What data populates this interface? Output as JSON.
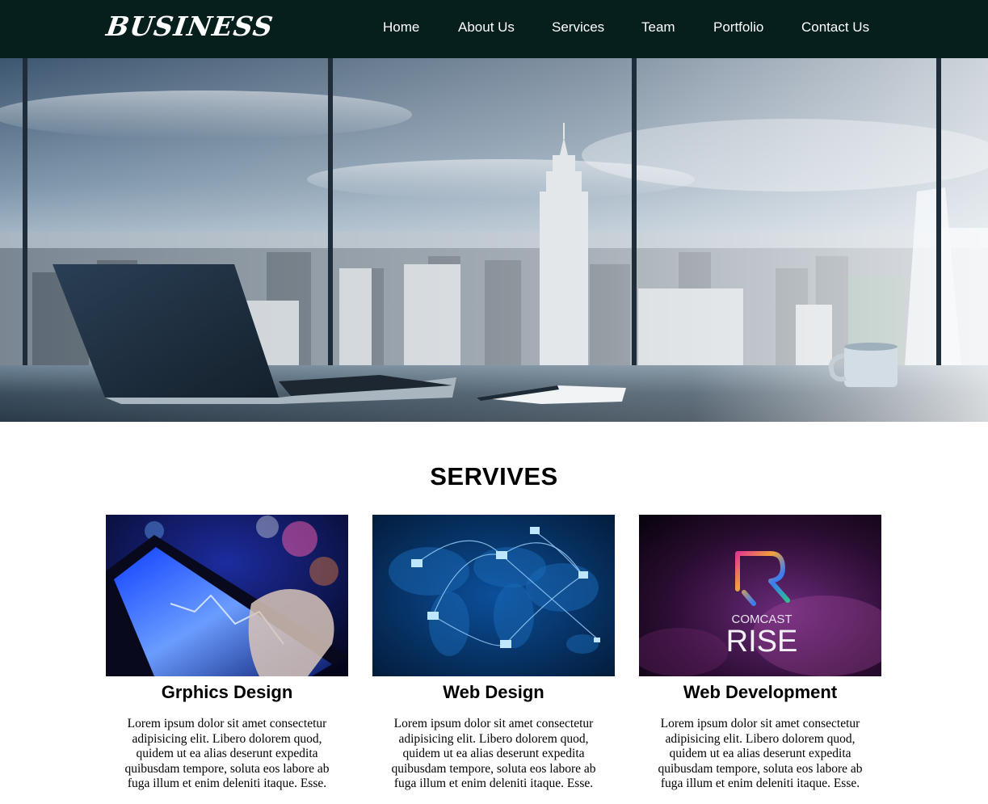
{
  "header": {
    "logo": "BUSINESS",
    "nav": [
      {
        "label": "Home"
      },
      {
        "label": "About Us"
      },
      {
        "label": "Services"
      },
      {
        "label": "Team"
      },
      {
        "label": "Portfolio"
      },
      {
        "label": "Contact Us"
      }
    ]
  },
  "hero": {
    "image": "office-skyline-photo"
  },
  "services": {
    "title": "SERVIVES",
    "cards": [
      {
        "image": "tablet-chart-photo",
        "title": "Grphics Design",
        "text": "Lorem ipsum dolor sit amet consectetur adipisicing elit. Libero dolorem quod, quidem ut ea alias deserunt expedita quibusdam tempore, soluta eos labore ab fuga illum et enim deleniti itaque. Esse."
      },
      {
        "image": "world-network-photo",
        "title": "Web Design",
        "text": "Lorem ipsum dolor sit amet consectetur adipisicing elit. Libero dolorem quod, quidem ut ea alias deserunt expedita quibusdam tempore, soluta eos labore ab fuga illum et enim deleniti itaque. Esse."
      },
      {
        "image": "comcast-rise-logo-photo",
        "title": "Web Development",
        "text": "Lorem ipsum dolor sit amet consectetur adipisicing elit. Libero dolorem quod, quidem ut ea alias deserunt expedita quibusdam tempore, soluta eos labore ab fuga illum et enim deleniti itaque. Esse.",
        "logo_text": [
          "COMCAST",
          "RISE"
        ]
      }
    ]
  },
  "colors": {
    "header_bg": "#061f1d",
    "nav_text": "#ffffff",
    "body_text": "#000000"
  }
}
